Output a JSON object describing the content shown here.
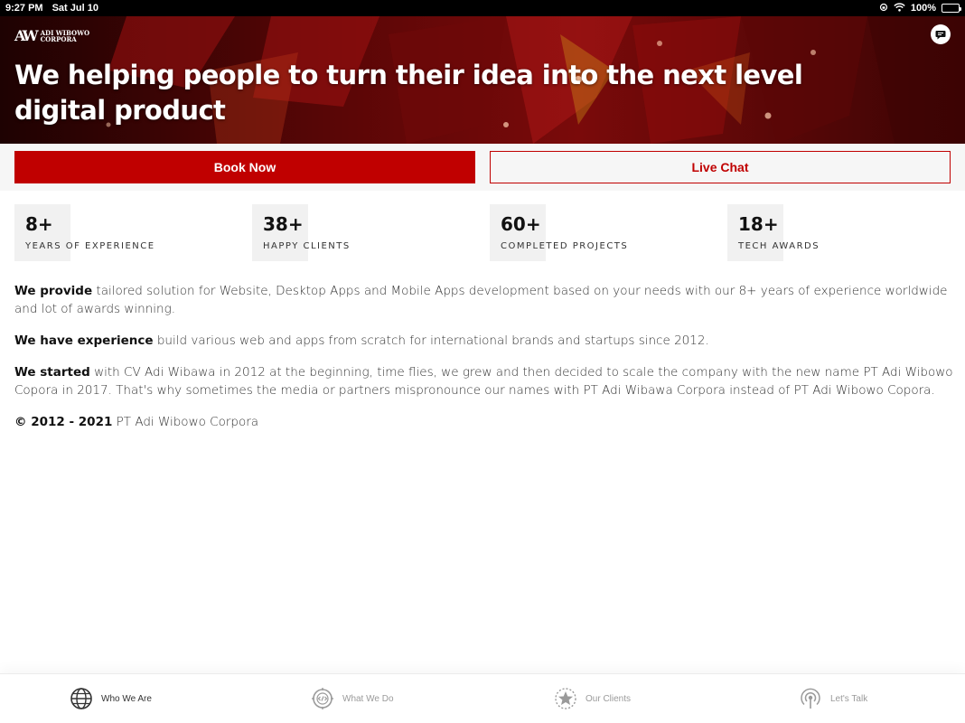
{
  "status_bar": {
    "time": "9:27 PM",
    "date": "Sat Jul 10",
    "battery": "100%"
  },
  "hero": {
    "logo_mark": "AW",
    "logo_line1": "ADI WIBOWO",
    "logo_line2": "CORPORA",
    "title": "We helping people to turn their idea into the next level digital product",
    "chat_icon": "chat-bubble-icon"
  },
  "cta": {
    "book_label": "Book Now",
    "chat_label": "Live Chat"
  },
  "stats": [
    {
      "number": "8+",
      "label": "YEARS OF EXPERIENCE"
    },
    {
      "number": "38+",
      "label": "HAPPY CLIENTS"
    },
    {
      "number": "60+",
      "label": "COMPLETED PROJECTS"
    },
    {
      "number": "18+",
      "label": "TECH AWARDS"
    }
  ],
  "content": {
    "p1_bold": "We provide",
    "p1_text": " tailored solution for Website, Desktop Apps and Mobile Apps development based on your needs with our 8+ years of experience worldwide and lot of awards winning.",
    "p2_bold": "We have experience",
    "p2_text": " build various web and apps from scratch for international brands and startups since 2012.",
    "p3_bold": "We started",
    "p3_text": " with CV Adi Wibawa in 2012 at the beginning, time flies, we grew and then decided to scale the company with the new name PT Adi Wibowo Copora in 2017. That's why sometimes the media or partners mispronounce our names with PT Adi Wibawa Corpora instead of PT Adi Wibowo Copora.",
    "copyright_bold": "© 2012 - 2021",
    "copyright_text": " PT Adi Wibowo Corpora"
  },
  "nav": {
    "items": [
      {
        "label": "Who We Are",
        "icon": "globe-icon",
        "active": true
      },
      {
        "label": "What We Do",
        "icon": "code-icon",
        "active": false
      },
      {
        "label": "Our Clients",
        "icon": "star-icon",
        "active": false
      },
      {
        "label": "Let's Talk",
        "icon": "broadcast-icon",
        "active": false
      }
    ]
  },
  "colors": {
    "accent": "#c00000",
    "nav_active": "#333333",
    "nav_inactive": "#9a9a9a"
  }
}
